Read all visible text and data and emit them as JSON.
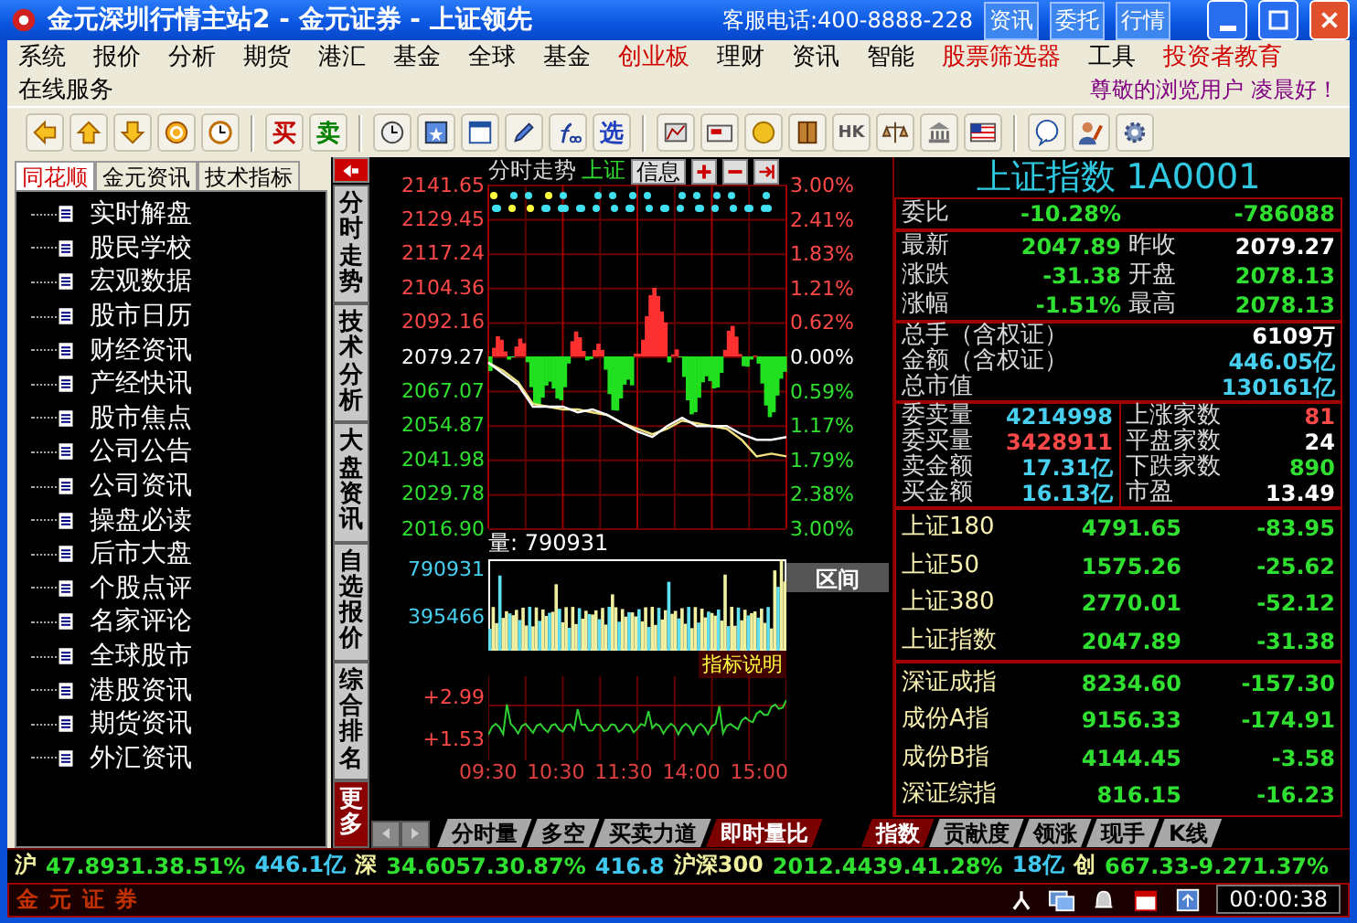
{
  "window": {
    "title": "金元深圳行情主站2 - 金元证券 - 上证领先",
    "hotline": "客服电话:400-8888-228",
    "quick_buttons": [
      "资讯",
      "委托",
      "行情"
    ]
  },
  "menu": [
    {
      "label": "系统",
      "highlight": false
    },
    {
      "label": "报价",
      "highlight": false
    },
    {
      "label": "分析",
      "highlight": false
    },
    {
      "label": "期货",
      "highlight": false
    },
    {
      "label": "港汇",
      "highlight": false
    },
    {
      "label": "基金",
      "highlight": false
    },
    {
      "label": "全球",
      "highlight": false
    },
    {
      "label": "基金",
      "highlight": false
    },
    {
      "label": "创业板",
      "highlight": true
    },
    {
      "label": "理财",
      "highlight": false
    },
    {
      "label": "资讯",
      "highlight": false
    },
    {
      "label": "智能",
      "highlight": false
    },
    {
      "label": "股票筛选器",
      "highlight": true
    },
    {
      "label": "工具",
      "highlight": false
    },
    {
      "label": "投资者教育",
      "highlight": true
    }
  ],
  "menu_second": {
    "item": "在线服务",
    "greeting": "尊敬的浏览用户 凌晨好！"
  },
  "toolbar": {
    "trade_buttons": [
      "买",
      "卖"
    ],
    "select_button": "选",
    "hk_label": "HK"
  },
  "left_tabs": [
    {
      "label": "同花顺",
      "selected": true
    },
    {
      "label": "金元资讯",
      "selected": false
    },
    {
      "label": "技术指标",
      "selected": false
    }
  ],
  "news_tree": [
    "实时解盘",
    "股民学校",
    "宏观数据",
    "股市日历",
    "财经资讯",
    "产经快讯",
    "股市焦点",
    "公司公告",
    "公司资讯",
    "操盘必读",
    "后市大盘",
    "个股点评",
    "名家评论",
    "全球股市",
    "港股资讯",
    "期货资讯",
    "外汇资讯"
  ],
  "side_tabs": [
    {
      "label": "分时走势",
      "kind": "tab"
    },
    {
      "label": "技术分析",
      "kind": "tab"
    },
    {
      "label": "大盘资讯",
      "kind": "tab"
    },
    {
      "label": "自选报价",
      "kind": "tab"
    },
    {
      "label": "综合排名",
      "kind": "tab"
    },
    {
      "label": "更多",
      "kind": "more"
    }
  ],
  "chart": {
    "title": "分时走势",
    "index_name": "上证",
    "info_button": "信息",
    "chart_data": {
      "type": "line",
      "categories": [
        null,
        null,
        null,
        null,
        null,
        null,
        null,
        null,
        null,
        null,
        null,
        null,
        null,
        null,
        null,
        null,
        null,
        null,
        null,
        null,
        null
      ],
      "series": [
        {
          "color": "#ffffff",
          "values": [
            2077,
            2073,
            2069,
            2061,
            2061,
            2061,
            2059,
            2060,
            2058,
            2055,
            2052,
            2050,
            2054,
            2057,
            2054,
            2054,
            2054,
            2051,
            2049,
            2049,
            2050
          ]
        },
        {
          "color": "#f0e080",
          "values": [
            2077,
            2074,
            2070,
            2062,
            2061,
            2060,
            2060,
            2059,
            2058,
            2055,
            2053,
            2051,
            2053,
            2056,
            2055,
            2054,
            2053,
            2049,
            2043,
            2044,
            2043
          ]
        }
      ],
      "ylim": [
        2016.9,
        2141.65
      ],
      "grid": true,
      "yticks": [
        {
          "value": 2016.9,
          "label": "2016.90"
        },
        {
          "value": 2029.78,
          "label": "2029.78"
        },
        {
          "value": 2041.98,
          "label": "2041.98"
        },
        {
          "value": 2054.87,
          "label": "2054.87"
        },
        {
          "value": 2067.07,
          "label": "2067.07"
        },
        {
          "value": 2079.27,
          "label": "2079.27"
        },
        {
          "value": 2092.16,
          "label": "2092.16"
        },
        {
          "value": 2104.36,
          "label": "2104.36"
        },
        {
          "value": 2117.24,
          "label": "2117.24"
        },
        {
          "value": 2129.45,
          "label": "2129.45"
        },
        {
          "value": 2141.65,
          "label": "2141.65"
        }
      ]
    },
    "pct_axis": [
      {
        "label": "3.00%",
        "color": "#ff4848"
      },
      {
        "label": "2.41%",
        "color": "#ff4848"
      },
      {
        "label": "1.83%",
        "color": "#ff4848"
      },
      {
        "label": "1.21%",
        "color": "#ff4848"
      },
      {
        "label": "0.62%",
        "color": "#ff4848"
      },
      {
        "label": "0.00%",
        "color": "#ffffff"
      },
      {
        "label": "0.59%",
        "color": "#30e030"
      },
      {
        "label": "1.17%",
        "color": "#30e030"
      },
      {
        "label": "1.79%",
        "color": "#30e030"
      },
      {
        "label": "2.38%",
        "color": "#30e030"
      },
      {
        "label": "3.00%",
        "color": "#30e030"
      }
    ],
    "times": [
      "09:30",
      "10:30",
      "11:30",
      "14:00",
      "15:00"
    ],
    "volume_title": "量: 790931",
    "volume_axis": [
      "790931",
      "395466"
    ],
    "range_button": "区间",
    "indicator_button": "指标说明",
    "indicator_axis": [
      "+2.99",
      "+1.53"
    ]
  },
  "quote": {
    "title": "上证指数 1A0001",
    "ratio": {
      "label": "委比",
      "pct": "-10.28%",
      "diff": "-786088"
    },
    "rows": [
      {
        "left": {
          "label": "最新",
          "value": "2047.89",
          "color": "#30e030"
        },
        "right": {
          "label": "昨收",
          "value": "2079.27",
          "color": "#ffffff"
        }
      },
      {
        "left": {
          "label": "涨跌",
          "value": "-31.38",
          "color": "#30e030"
        },
        "right": {
          "label": "开盘",
          "value": "2078.13",
          "color": "#30e030"
        }
      },
      {
        "left": {
          "label": "涨幅",
          "value": "-1.51%",
          "color": "#30e030"
        },
        "right": {
          "label": "最高",
          "value": "2078.13",
          "color": "#30e030"
        }
      }
    ],
    "totals": [
      {
        "label": "总手（含权证）",
        "value": "6109万",
        "color": "#ffffff"
      },
      {
        "label": "金额（含权证）",
        "value": "446.05亿",
        "color": "#48d0f0"
      },
      {
        "label": "总市值",
        "value": "130161亿",
        "color": "#48d0f0"
      }
    ],
    "book": [
      {
        "left": {
          "label": "委卖量",
          "value": "4214998",
          "color": "#48d0f0"
        },
        "right": {
          "label": "上涨家数",
          "value": "81",
          "color": "#ff4848"
        }
      },
      {
        "left": {
          "label": "委买量",
          "value": "3428911",
          "color": "#ff4848"
        },
        "right": {
          "label": "平盘家数",
          "value": "24",
          "color": "#ffffff"
        }
      },
      {
        "left": {
          "label": "卖金额",
          "value": "17.31亿",
          "color": "#48d0f0"
        },
        "right": {
          "label": "下跌家数",
          "value": "890",
          "color": "#30e030"
        }
      },
      {
        "left": {
          "label": "买金额",
          "value": "16.13亿",
          "color": "#48d0f0"
        },
        "right": {
          "label": "市盈",
          "value": "13.49",
          "color": "#ffffff"
        }
      }
    ],
    "sh_indices": [
      {
        "name": "上证180",
        "value": "4791.65",
        "change": "-83.95"
      },
      {
        "name": "上证50",
        "value": "1575.26",
        "change": "-25.62"
      },
      {
        "name": "上证380",
        "value": "2770.01",
        "change": "-52.12"
      },
      {
        "name": "上证指数",
        "value": "2047.89",
        "change": "-31.38"
      }
    ],
    "sz_indices": [
      {
        "name": "深证成指",
        "value": "8234.60",
        "change": "-157.30"
      },
      {
        "name": "成份A指",
        "value": "9156.33",
        "change": "-174.91"
      },
      {
        "name": "成份B指",
        "value": "4144.45",
        "change": "-3.58"
      },
      {
        "name": "深证综指",
        "value": "816.15",
        "change": "-16.23"
      }
    ]
  },
  "chart_tabs": [
    {
      "label": "分时量",
      "selected": false
    },
    {
      "label": "多空",
      "selected": false
    },
    {
      "label": "买卖力道",
      "selected": false
    },
    {
      "label": "即时量比",
      "selected": true
    }
  ],
  "quote_tabs": [
    {
      "label": "指数",
      "selected": true
    },
    {
      "label": "贡献度",
      "selected": false
    },
    {
      "label": "领涨",
      "selected": false
    },
    {
      "label": "现手",
      "selected": false
    },
    {
      "label": "K线",
      "selected": false
    }
  ],
  "ticker": [
    {
      "text": "沪",
      "kind": "market"
    },
    {
      "text": "47.8931.38.51%",
      "kind": "quote"
    },
    {
      "text": "446.1亿",
      "kind": "amount"
    },
    {
      "text": "深",
      "kind": "market"
    },
    {
      "text": "34.6057.30.87%",
      "kind": "quote"
    },
    {
      "text": "416.8",
      "kind": "amount"
    },
    {
      "text": "沪深300",
      "kind": "market"
    },
    {
      "text": "2012.4439.41.28%",
      "kind": "quote"
    },
    {
      "text": "18亿",
      "kind": "amount"
    },
    {
      "text": "创",
      "kind": "market"
    },
    {
      "text": "667.33-9.271.37%",
      "kind": "quote"
    }
  ],
  "status_bar": {
    "logo": "金元证券",
    "clock": "00:00:38"
  }
}
